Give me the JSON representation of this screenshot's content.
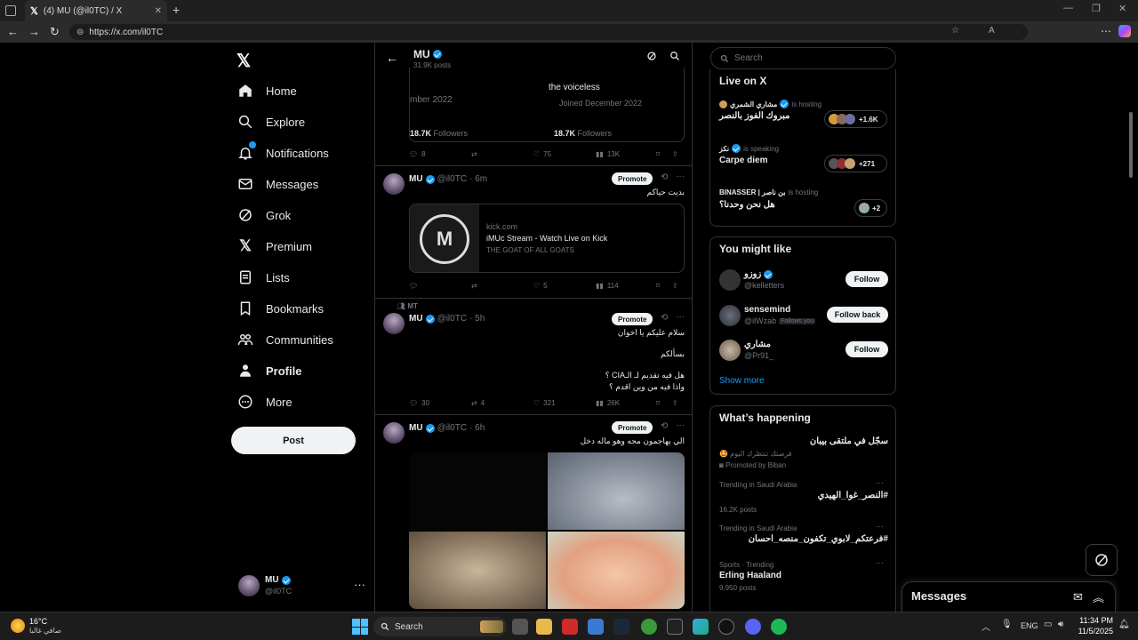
{
  "browser": {
    "tab_title": "(4) MU (@il0TC) / X",
    "url": "https://x.com/il0TC"
  },
  "nav": {
    "items": [
      {
        "label": "Home",
        "icon": "home-icon"
      },
      {
        "label": "Explore",
        "icon": "search-icon"
      },
      {
        "label": "Notifications",
        "icon": "bell-icon"
      },
      {
        "label": "Messages",
        "icon": "envelope-icon"
      },
      {
        "label": "Grok",
        "icon": "grok-icon"
      },
      {
        "label": "Premium",
        "icon": "x-logo-icon"
      },
      {
        "label": "Lists",
        "icon": "list-icon"
      },
      {
        "label": "Bookmarks",
        "icon": "bookmark-icon"
      },
      {
        "label": "Communities",
        "icon": "people-icon"
      },
      {
        "label": "Profile",
        "icon": "person-icon"
      },
      {
        "label": "More",
        "icon": "more-circle-icon"
      }
    ],
    "post_label": "Post",
    "account_name": "MU",
    "account_handle": "@il0TC"
  },
  "header": {
    "name": "MU",
    "posts_count": "31.9K posts"
  },
  "card_top": {
    "left_text": "mber 2022",
    "right_text": "the voiceless",
    "joined": "Joined December 2022",
    "left_followers_num": "18.7K",
    "right_followers_num": "18.7K",
    "followers_label": "Followers"
  },
  "post1": {
    "replies": "8",
    "likes": "75",
    "views": "13K"
  },
  "post2": {
    "name": "MU",
    "handle": "@il0TC",
    "time": "· 6m",
    "promote": "Promote",
    "text": "بديت حياكم",
    "link_domain": "kick.com",
    "link_title": "iMUc Stream - Watch Live on Kick",
    "link_desc": "THE GOAT OF ALL GOATS",
    "likes": "5",
    "views": "114"
  },
  "post3": {
    "pinned_by": "MT",
    "name": "MU",
    "handle": "@il0TC",
    "time": "· 5h",
    "promote": "Promote",
    "line1": "سلام عليكم يا اخوان",
    "line2": "بسألكم",
    "line3": "هل فيه تقديم لـ الـCIA ؟",
    "line4": "واذا فيه من وين اقدم ؟",
    "replies": "30",
    "retweets": "4",
    "likes": "321",
    "views": "26K"
  },
  "post4": {
    "name": "MU",
    "handle": "@il0TC",
    "time": "· 6h",
    "promote": "Promote",
    "text": "الي يهاجمون مجه وهو ماله دخل"
  },
  "search": {
    "placeholder": "Search"
  },
  "live": {
    "title": "Live on X",
    "items": [
      {
        "host": "مشاري الشمري",
        "status": "is hosting",
        "title": "مبروك الفوز بالنصر",
        "count": "+1.6K"
      },
      {
        "host": "نكز",
        "status": "is speaking",
        "title": "Carpe diem",
        "count": "+271"
      },
      {
        "host": "BINASSER | بن ناصر",
        "status": "is hosting",
        "title": "هل نحن وحدنا؟",
        "count": "+2"
      }
    ]
  },
  "suggest": {
    "title": "You might like",
    "items": [
      {
        "name": "زوزو",
        "handle": "@kelletters",
        "button": "Follow",
        "badge": ""
      },
      {
        "name": "sensemind",
        "handle": "@ilWzab",
        "button": "Follow back",
        "badge": "Follows you"
      },
      {
        "name": "مشاري",
        "handle": "@Pr91_",
        "button": "Follow",
        "badge": ""
      }
    ],
    "show_more": "Show more"
  },
  "happening": {
    "title": "What’s happening",
    "promo_title": "سجّل في ملتقى بيبان",
    "promo_sub": "فرصتك تنتظرك اليوم 🤩",
    "promo_by": "Promoted by Biban",
    "trends": [
      {
        "context": "Trending in Saudi Arabia",
        "name": "#النصر_غوا_الهيدي",
        "posts": "16.2K posts"
      },
      {
        "context": "Trending in Saudi Arabia",
        "name": "#فرعتكم_لابوي_تكفون_منصه_احسان",
        "posts": ""
      },
      {
        "context": "Sports · Trending",
        "name": "Erling Haaland",
        "posts": "9,950 posts"
      }
    ]
  },
  "messages_dock": {
    "label": "Messages"
  },
  "taskbar": {
    "weather_temp": "16°C",
    "weather_desc": "صافي غالبا",
    "search_label": "Search",
    "lang": "ENG",
    "time": "11:34 PM",
    "date": "11/5/2025"
  }
}
